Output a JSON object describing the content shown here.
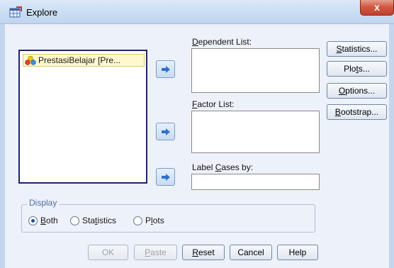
{
  "window": {
    "title": "Explore",
    "close_glyph": "x"
  },
  "icons": {
    "app": "data-editor-icon",
    "variable": "scale-variable-icon",
    "arrow": "move-right-arrow-icon"
  },
  "source_list": {
    "items": [
      {
        "label": "PrestasiBelajar [Pre..."
      }
    ]
  },
  "targets": {
    "dependent": {
      "pre": "",
      "mnemonic": "D",
      "post": "ependent List:"
    },
    "factor": {
      "pre": "",
      "mnemonic": "F",
      "post": "actor List:"
    },
    "label_cases": {
      "pre": "Label ",
      "mnemonic": "C",
      "post": "ases by:"
    }
  },
  "side_buttons": {
    "statistics": {
      "pre": "",
      "mnemonic": "S",
      "post": "tatistics..."
    },
    "plots": {
      "pre": "Plo",
      "mnemonic": "t",
      "post": "s..."
    },
    "options": {
      "pre": "",
      "mnemonic": "O",
      "post": "ptions..."
    },
    "bootstrap": {
      "pre": "",
      "mnemonic": "B",
      "post": "ootstrap..."
    }
  },
  "display": {
    "title": "Display",
    "selected": "both",
    "options": {
      "both": {
        "pre": "",
        "mnemonic": "B",
        "post": "oth"
      },
      "statistics": {
        "pre": "Sta",
        "mnemonic": "t",
        "post": "istics"
      },
      "plots": {
        "pre": "P",
        "mnemonic": "l",
        "post": "ots"
      }
    }
  },
  "bottom_buttons": {
    "ok": {
      "label": "OK",
      "enabled": false
    },
    "paste": {
      "pre": "",
      "mnemonic": "P",
      "post": "aste",
      "enabled": false
    },
    "reset": {
      "pre": "",
      "mnemonic": "R",
      "post": "eset",
      "enabled": true
    },
    "cancel": {
      "label": "Cancel",
      "enabled": true
    },
    "help": {
      "label": "Help",
      "enabled": true
    }
  },
  "colors": {
    "focus_border": "#23236e",
    "selection_bg": "#fff8cf",
    "arrow": "#2f6fcf",
    "group_title": "#4a6fa5"
  }
}
